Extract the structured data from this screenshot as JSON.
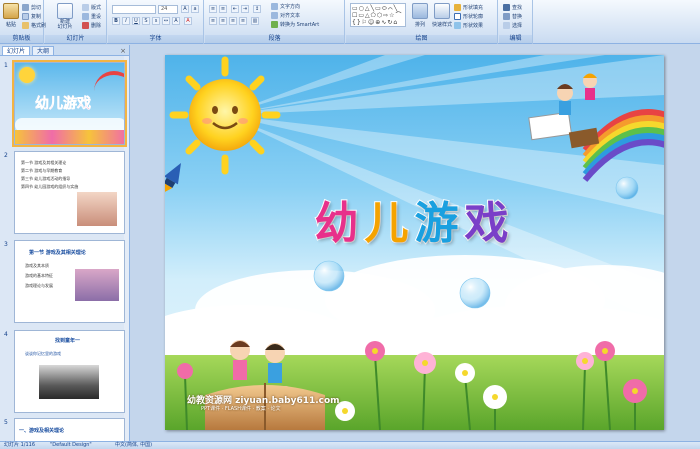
{
  "ribbon": {
    "groups": {
      "clipboard": "剪贴板",
      "slides": "幻灯片",
      "font": "字体",
      "paragraph": "段落",
      "drawing": "绘图",
      "editing": "编辑"
    },
    "clipboard": {
      "paste": "粘贴",
      "cut": "剪切",
      "copy": "复制",
      "format_painter": "格式刷"
    },
    "slides": {
      "new_slide": "新建\n幻灯片",
      "layout": "版式",
      "reset": "重设",
      "delete": "删除"
    },
    "font": {
      "font_name": "",
      "font_size": "24"
    },
    "paragraph": {
      "text_direction": "文字方向",
      "align_text": "对齐文本",
      "smartart": "转换为 SmartArt"
    },
    "drawing": {
      "arrange": "排列",
      "quick_styles": "快速样式",
      "shape_fill": "形状填充",
      "shape_outline": "形状轮廓",
      "shape_effects": "形状效果"
    },
    "editing": {
      "find": "查找",
      "replace": "替换",
      "select": "选择"
    }
  },
  "panel": {
    "tabs": [
      "幻灯片",
      "大纲"
    ],
    "close": "×",
    "thumbnails": [
      {
        "num": "1",
        "title": "幼儿游戏"
      },
      {
        "num": "2",
        "lines": [
          "第一节  游戏及其相关理论",
          "第二节  游戏与早期教育",
          "第三节  幼儿游戏活动的指导",
          "第四节  幼儿园游戏的组织与实施"
        ]
      },
      {
        "num": "3",
        "title": "第一节  游戏及其相关理论",
        "lines": [
          "游戏及其本质",
          "游戏的基本特征",
          "游戏理论与发展"
        ]
      },
      {
        "num": "4",
        "title": "找到童年一",
        "lines": [
          "谈谈你记忆里的游戏"
        ]
      },
      {
        "num": "5",
        "title": "一、游戏及相关理论"
      }
    ]
  },
  "slide": {
    "title_chars": [
      "幼",
      "儿",
      "游",
      "戏"
    ],
    "title_colors": [
      "#e8308b",
      "#f5a300",
      "#1aa0e0",
      "#7a3fc8"
    ],
    "watermark": "幼教资源网 ziyuan.baby611.com",
    "watermark_sub": "PPT课件 · FLASH课件 · 教案 · 论文"
  },
  "status": {
    "slide_counter": "幻灯片 1/116",
    "theme": "\"Default Design\"",
    "language": "中文(简体, 中国)"
  }
}
